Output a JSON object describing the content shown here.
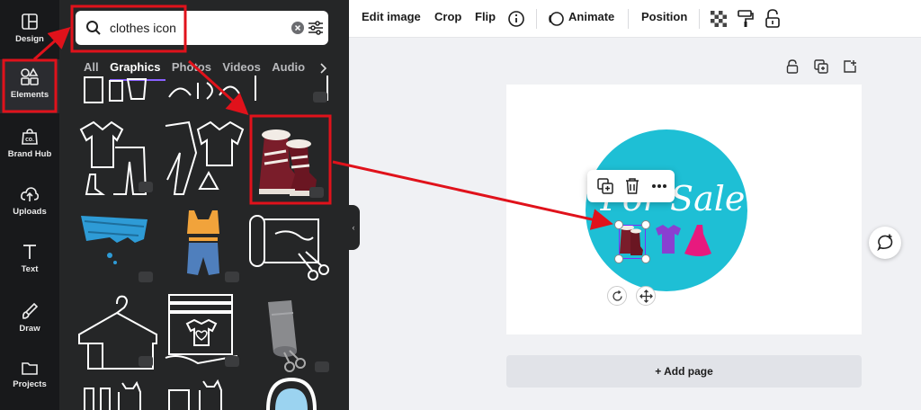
{
  "nav": {
    "items": [
      {
        "label": "Design",
        "icon": "layout-icon"
      },
      {
        "label": "Elements",
        "icon": "shapes-icon"
      },
      {
        "label": "Brand Hub",
        "icon": "brand-icon"
      },
      {
        "label": "Uploads",
        "icon": "cloud-upload-icon"
      },
      {
        "label": "Text",
        "icon": "text-icon"
      },
      {
        "label": "Draw",
        "icon": "brush-icon"
      },
      {
        "label": "Projects",
        "icon": "folder-icon"
      }
    ],
    "active": "Elements"
  },
  "search": {
    "value": "clothes icon"
  },
  "tabs": [
    "All",
    "Graphics",
    "Photos",
    "Videos",
    "Audio"
  ],
  "active_tab": "Graphics",
  "toolbar": {
    "edit_image": "Edit image",
    "crop": "Crop",
    "flip": "Flip",
    "animate": "Animate",
    "position": "Position"
  },
  "canvas": {
    "design_text": "For Sale",
    "add_page": "+ Add page"
  },
  "colors": {
    "rail_bg": "#18191b",
    "panel_bg": "#252627",
    "circle": "#1ebfd5",
    "highlight": "#e0121b",
    "selection": "#7b2ff7"
  }
}
